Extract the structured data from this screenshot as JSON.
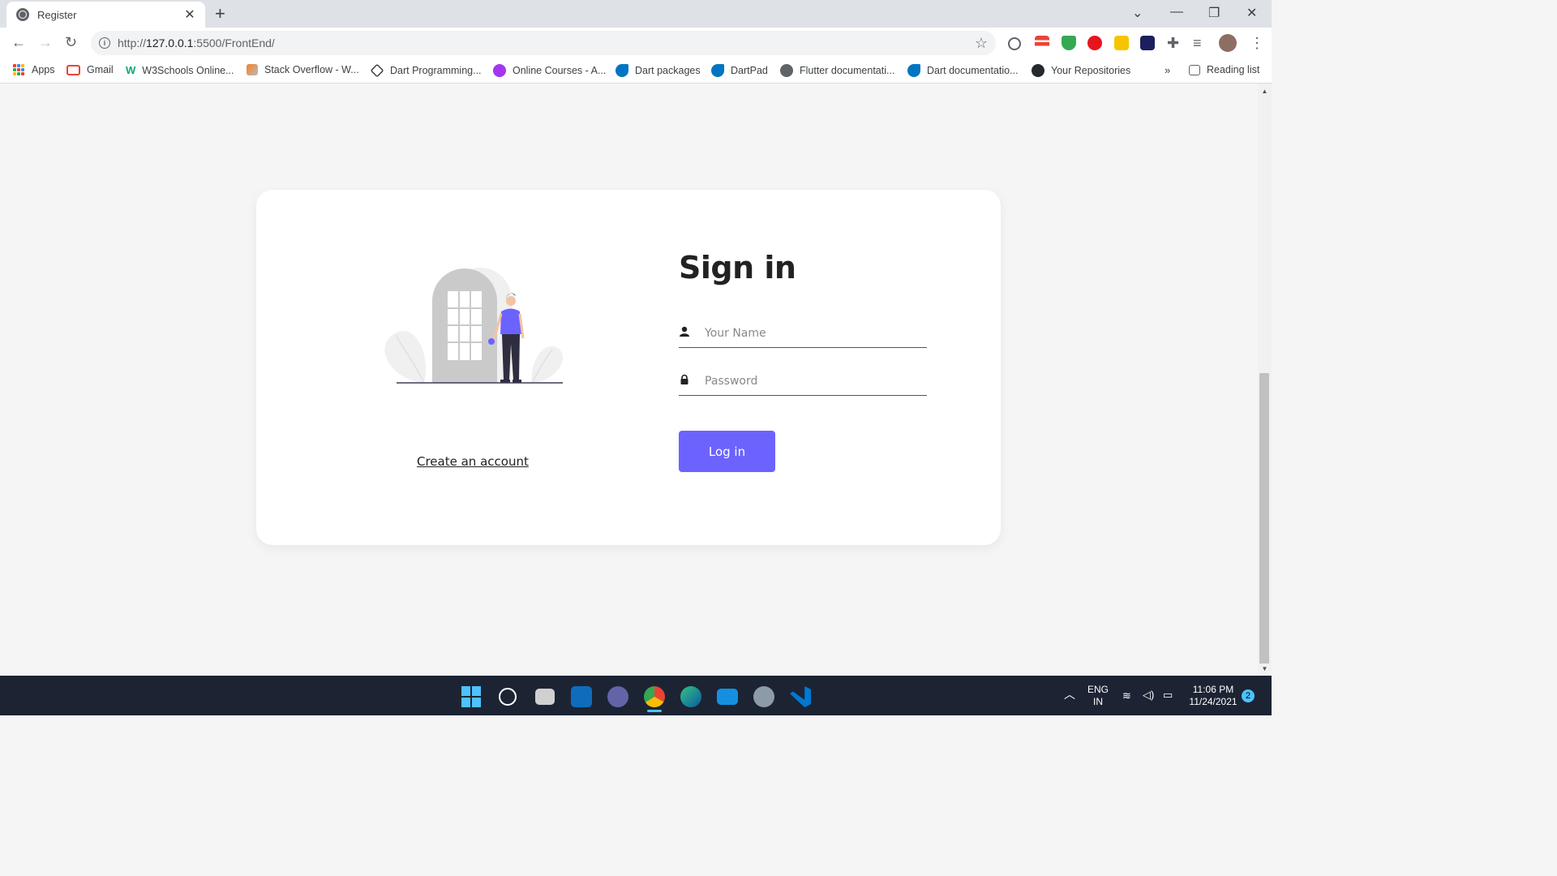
{
  "browser": {
    "tab_title": "Register",
    "tab_close": "✕",
    "new_tab": "+",
    "url_scheme": "http://",
    "url_host": "127.0.0.1",
    "url_rest": ":5500/FrontEnd/",
    "reading_list": "Reading list",
    "more_bookmarks": "»"
  },
  "bookmarks": [
    {
      "label": "Apps",
      "icon": "apps-grid-icon"
    },
    {
      "label": "Gmail",
      "icon": "gmail-icon"
    },
    {
      "label": "W3Schools Online...",
      "icon": "w3schools-icon"
    },
    {
      "label": "Stack Overflow - W...",
      "icon": "stackoverflow-icon"
    },
    {
      "label": "Dart Programming...",
      "icon": "dart-icon"
    },
    {
      "label": "Online Courses - A...",
      "icon": "udemy-icon"
    },
    {
      "label": "Dart packages",
      "icon": "dart-packages-icon"
    },
    {
      "label": "DartPad",
      "icon": "dartpad-icon"
    },
    {
      "label": "Flutter documentati...",
      "icon": "globe-icon"
    },
    {
      "label": "Dart documentatio...",
      "icon": "dart-docs-icon"
    },
    {
      "label": "Your Repositories",
      "icon": "github-icon"
    }
  ],
  "page": {
    "title": "Sign in",
    "name_placeholder": "Your Name",
    "password_placeholder": "Password",
    "login_label": "Log in",
    "create_account_label": "Create an account"
  },
  "colors": {
    "accent": "#6c63ff",
    "card_bg": "#ffffff",
    "page_bg": "#f5f5f5",
    "taskbar_bg": "#1c2434"
  },
  "taskbar": {
    "lang_line1": "ENG",
    "lang_line2": "IN",
    "time": "11:06 PM",
    "date": "11/24/2021",
    "notification_count": "2"
  }
}
